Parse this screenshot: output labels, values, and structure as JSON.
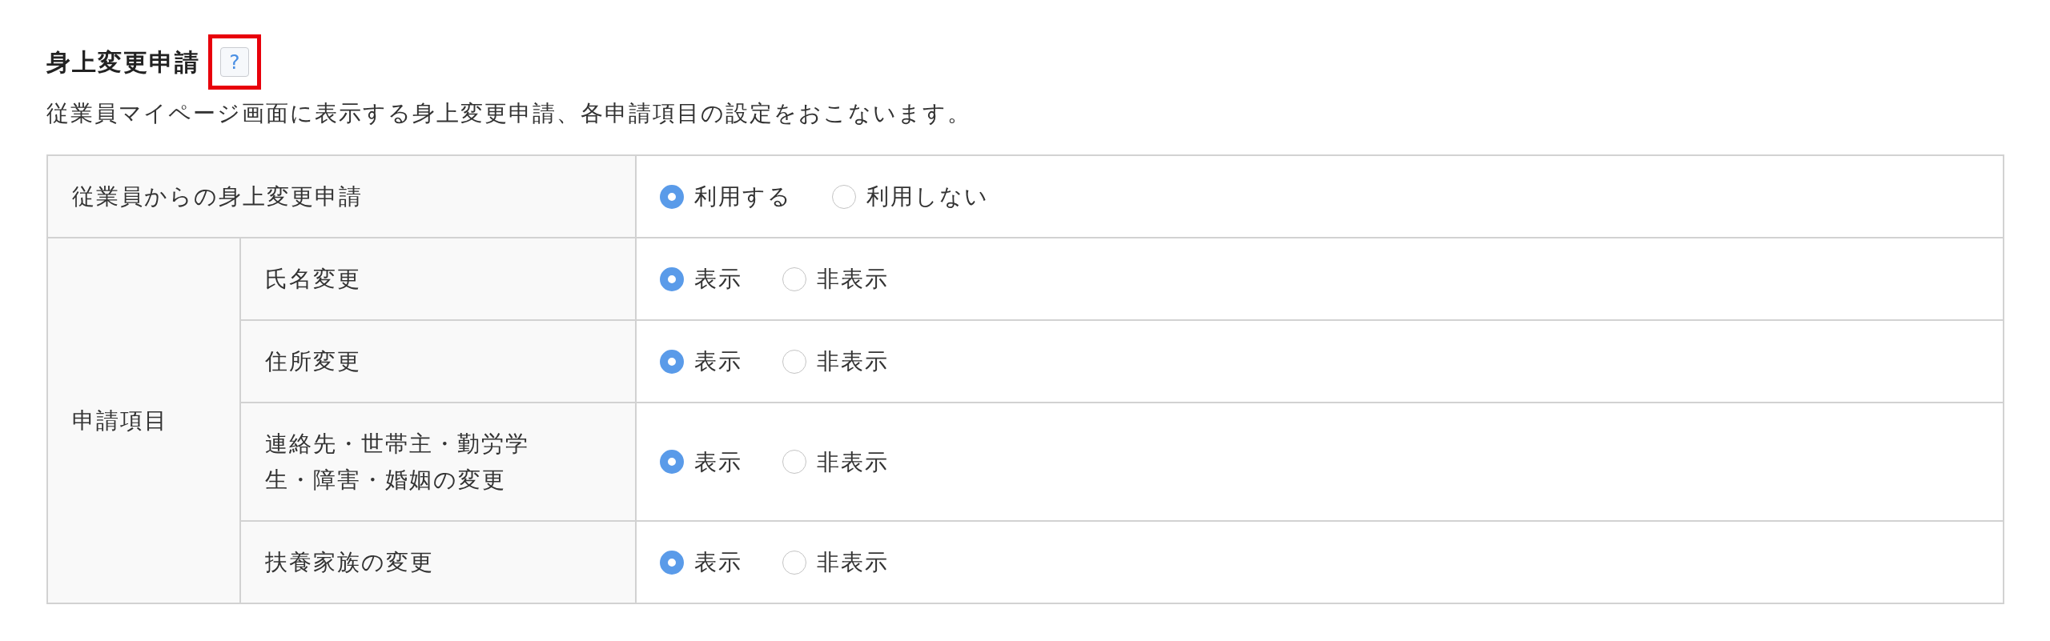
{
  "section": {
    "title": "身上変更申請",
    "help_button": {
      "label": "?",
      "highlighted": true
    },
    "description": "従業員マイページ画面に表示する身上変更申請、各申請項目の設定をおこないます。"
  },
  "table": {
    "rows": [
      {
        "kind": "single",
        "label": "従業員からの身上変更申請",
        "options": [
          {
            "label": "利用する",
            "selected": true
          },
          {
            "label": "利用しない",
            "selected": false
          }
        ]
      },
      {
        "kind": "group",
        "label": "申請項目",
        "children": [
          {
            "label": "氏名変更",
            "options": [
              {
                "label": "表示",
                "selected": true
              },
              {
                "label": "非表示",
                "selected": false
              }
            ]
          },
          {
            "label": "住所変更",
            "options": [
              {
                "label": "表示",
                "selected": true
              },
              {
                "label": "非表示",
                "selected": false
              }
            ]
          },
          {
            "label": "連絡先・世帯主・勤労学生・障害・婚姻の変更",
            "options": [
              {
                "label": "表示",
                "selected": true
              },
              {
                "label": "非表示",
                "selected": false
              }
            ]
          },
          {
            "label": "扶養家族の変更",
            "options": [
              {
                "label": "表示",
                "selected": true
              },
              {
                "label": "非表示",
                "selected": false
              }
            ]
          }
        ]
      }
    ]
  }
}
